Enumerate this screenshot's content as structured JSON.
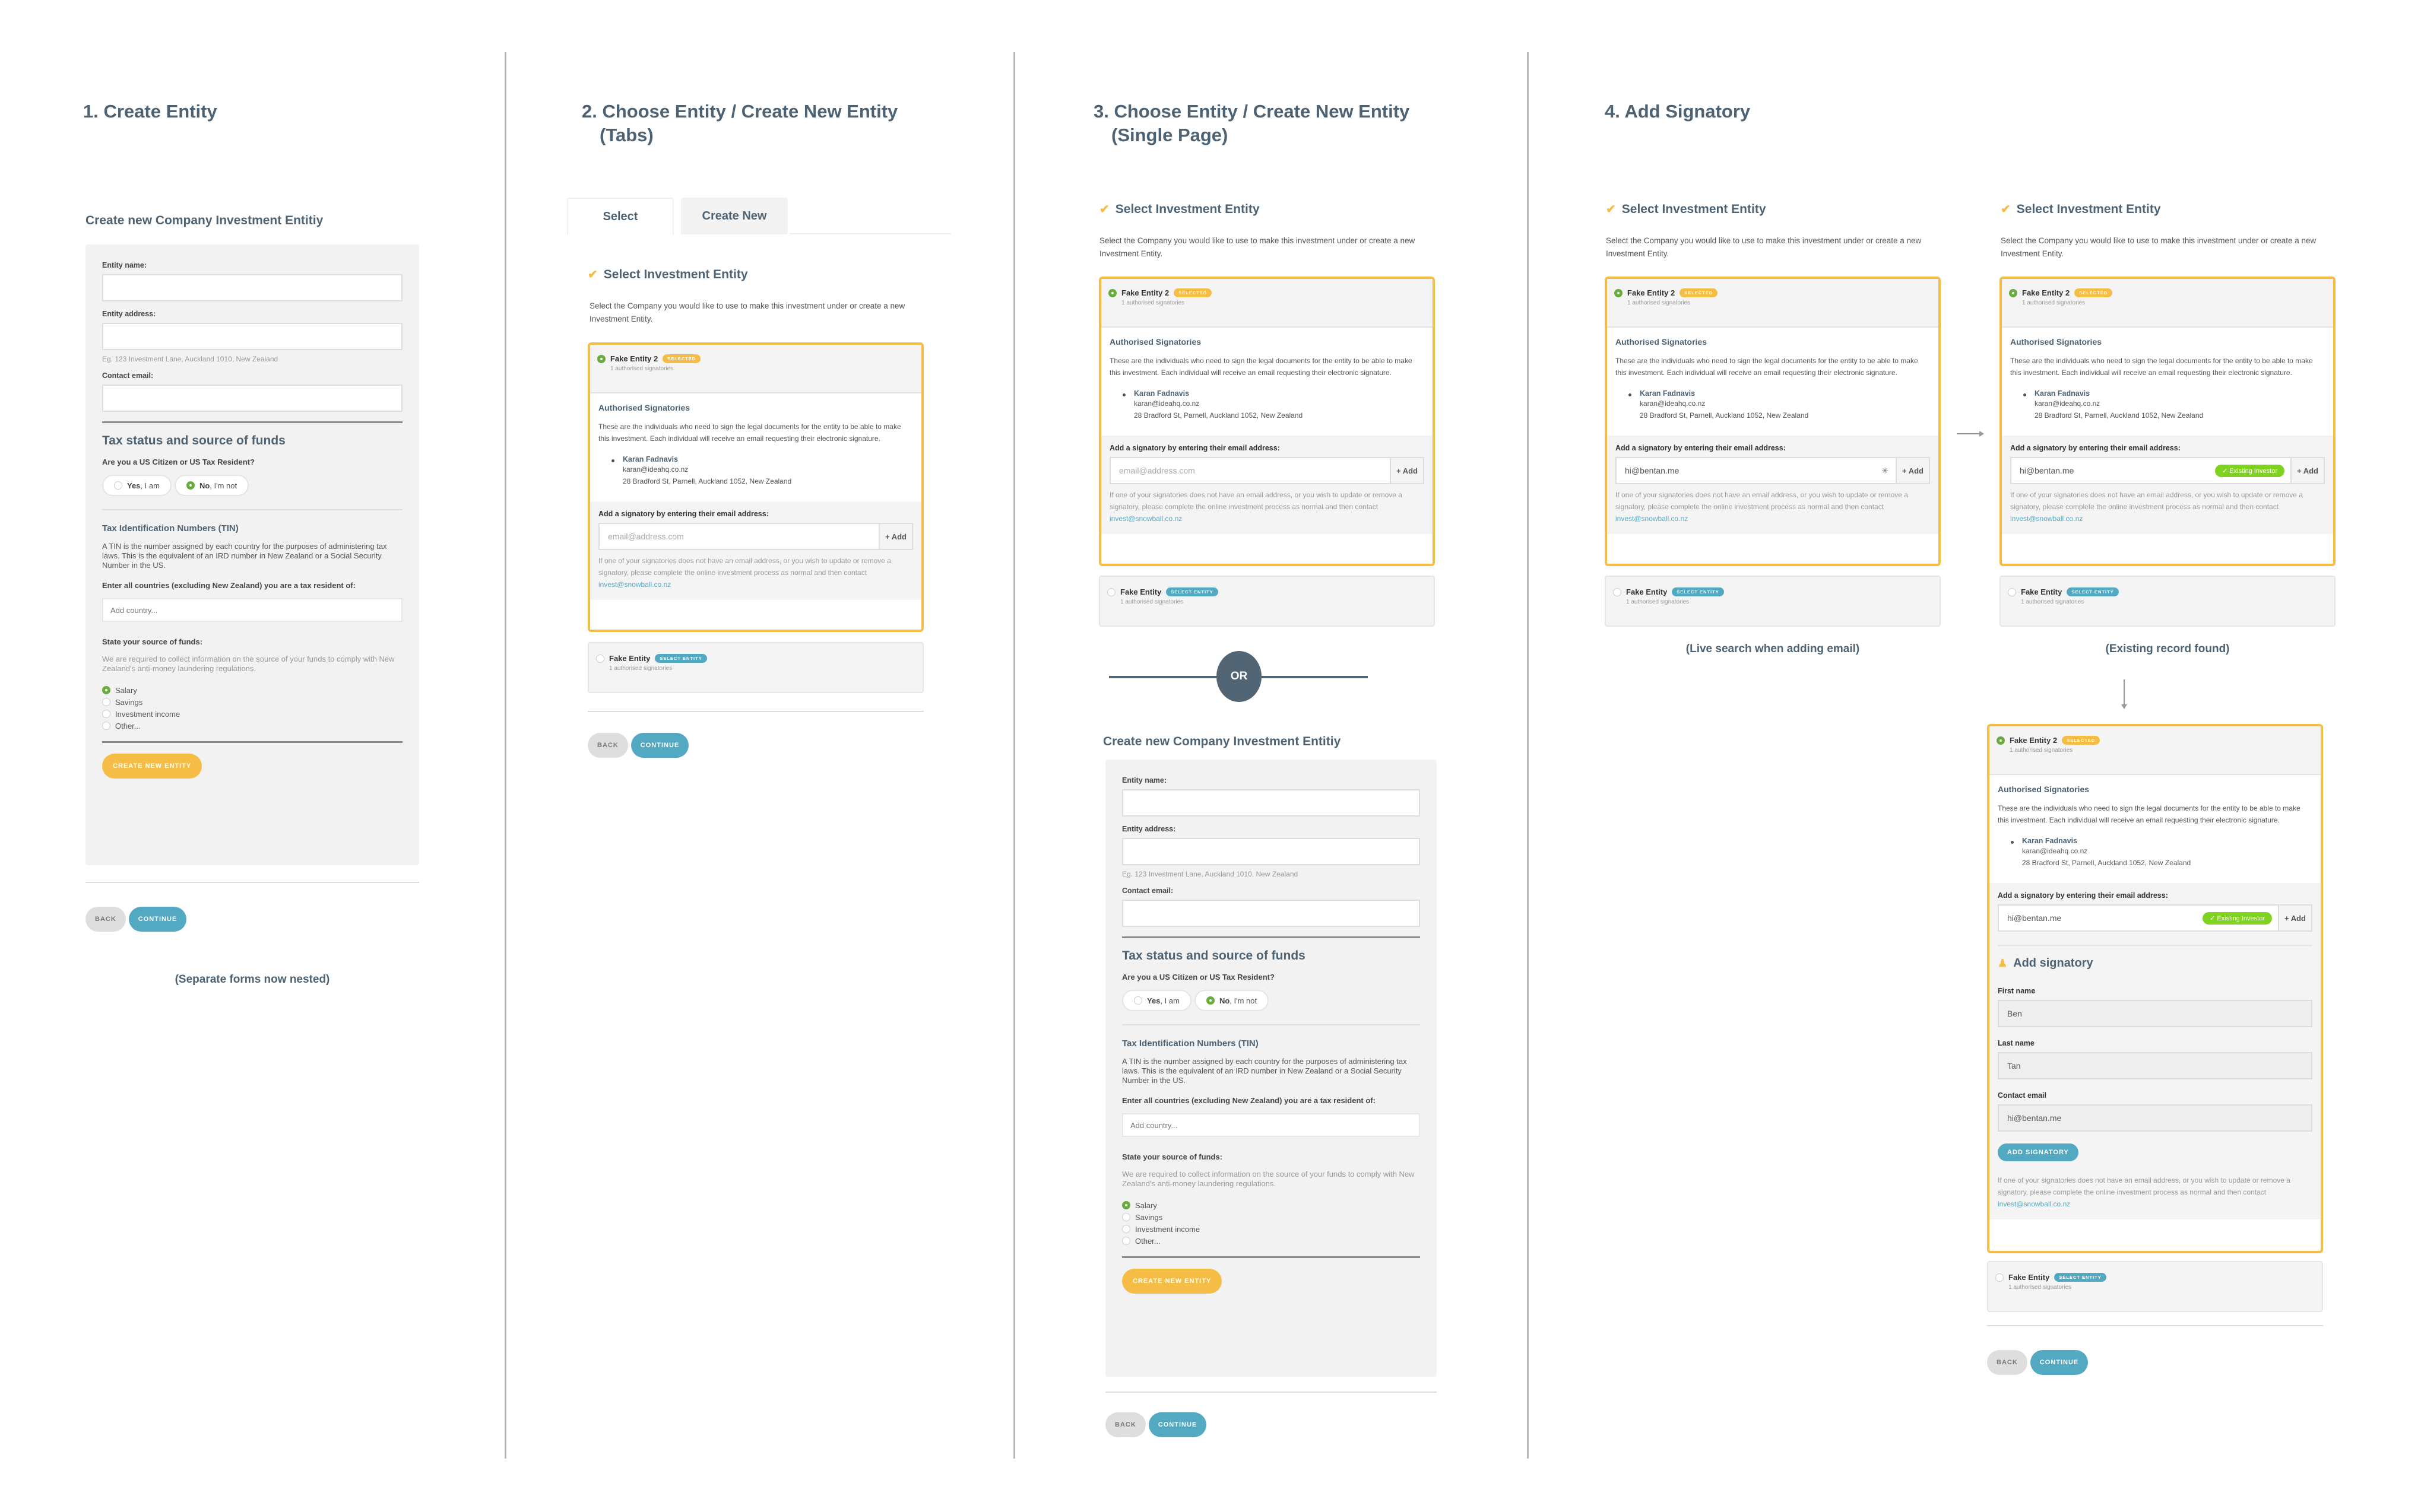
{
  "common": {
    "select_heading": "Select Investment Entity",
    "select_desc": "Select the Company you would like to use to make this investment under or create a new Investment Entity.",
    "selected_entity": {
      "name": "Fake Entity 2",
      "badge": "SELECTED",
      "sub": "1 authorised signatories"
    },
    "other_entity": {
      "name": "Fake Entity",
      "badge": "SELECT ENTITY",
      "sub": "1 authorised signatories"
    },
    "auth_heading": "Authorised Signatories",
    "auth_desc": "These are the individuals who need to sign the legal documents for the entity to be able to make this investment. Each individual will receive an email requesting their electronic signature.",
    "signatory": {
      "name": "Karan Fadnavis",
      "email": "karan@ideahq.co.nz",
      "address": "28 Bradford St, Parnell, Auckland 1052, New Zealand"
    },
    "add_label": "Add a signatory by entering their email address:",
    "email_placeholder": "email@address.com",
    "add_button": "+ Add",
    "note_text": "If one of your signatories does not have an email address, or you wish to update or remove a signatory, please complete the online investment process as normal and then contact ",
    "note_link": "invest@snowball.co.nz",
    "back": "BACK",
    "continue": "CONTINUE",
    "check_icon": "✔"
  },
  "form": {
    "heading": "Create new Company Investment Entitiy",
    "entity_name_label": "Entity name:",
    "entity_address_label": "Entity address:",
    "address_hint": "Eg. 123 Investment Lane, Auckland 1010, New Zealand",
    "contact_email_label": "Contact email:",
    "tax_heading": "Tax status and source of funds",
    "us_question": "Are you a US Citizen or US Tax Resident?",
    "yes_bold": "Yes",
    "yes_rest": ", I am",
    "no_bold": "No",
    "no_rest": ", I'm not",
    "tin_heading": "Tax Identification Numbers (TIN)",
    "tin_desc": "A TIN is the number assigned by each country for the purposes of administering tax laws. This is the equivalent of an IRD number in New Zealand or a Social Security Number in the US.",
    "countries_label": "Enter all countries (excluding New Zealand) you are a tax resident of:",
    "country_placeholder": "Add country...",
    "funds_label": "State your source of funds:",
    "funds_desc": "We are required to collect information on the source of your funds to comply with New Zealand's anti-money laundering regulations.",
    "funds_options": [
      "Salary",
      "Savings",
      "Investment income",
      "Other..."
    ],
    "funds_selected": "Salary",
    "create_button": "CREATE NEW ENTITY"
  },
  "col1": {
    "title": "1. Create Entity",
    "caption": "(Separate forms now nested)"
  },
  "col2": {
    "title_line1": "2. Choose Entity / Create New Entity",
    "title_line2": "(Tabs)",
    "tabs": [
      "Select",
      "Create New"
    ],
    "active_tab": "Select"
  },
  "col3": {
    "title_line1": "3. Choose Entity / Create New Entity",
    "title_line2": "(Single Page)",
    "or_label": "OR"
  },
  "col4": {
    "title": "4. Add Signatory",
    "live_search_value": "hi@bentan.me",
    "live_caption": "(Live search when adding email)",
    "existing_caption": "(Existing record found)",
    "existing_badge": "✓ Existing Investor",
    "add_sig_heading": "Add signatory",
    "first_name_label": "First name",
    "first_name_value": "Ben",
    "last_name_label": "Last name",
    "last_name_value": "Tan",
    "contact_email_label": "Contact email",
    "contact_email_value": "hi@bentan.me",
    "add_sig_button": "ADD SIGNATORY"
  },
  "colors": {
    "accent_yellow": "#f5bd45",
    "accent_blue": "#53a9c2",
    "heading": "#4d6273",
    "success_green": "#7fd320",
    "radio_green": "#6aab3d"
  }
}
